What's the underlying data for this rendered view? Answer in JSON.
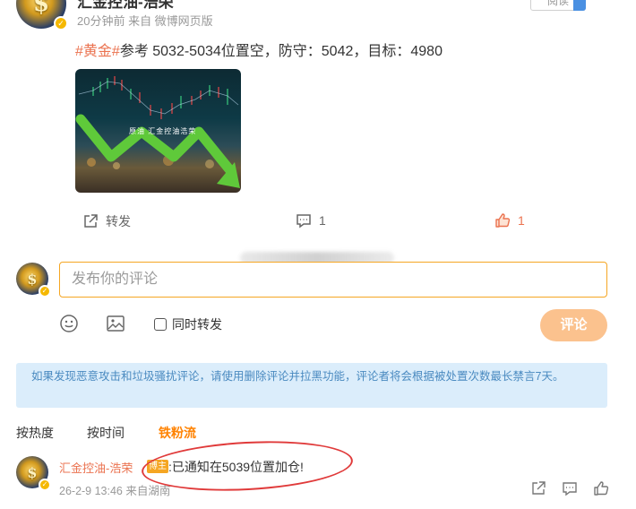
{
  "post": {
    "author": "汇金控油-浩荣",
    "meta": "20分钟前  来自 微博网页版",
    "follow_label": "阅读",
    "hashtag": "#黄金#",
    "text": "参考 5032-5034位置空，防守：5042，目标：4980",
    "image_caption": "原油 汇金控油浩荣"
  },
  "actions": {
    "repost_label": "转发",
    "comment_count": "1",
    "like_count": "1"
  },
  "composer": {
    "placeholder": "发布你的评论",
    "repost_option_label": "同时转发",
    "submit_label": "评论"
  },
  "notice": "如果发现恶意攻击和垃圾骚扰评论，请使用删除评论并拉黑功能，评论者将会根据被处置次数最长禁言7天。",
  "sort_tabs": [
    "按热度",
    "按时间",
    "铁粉流"
  ],
  "active_sort_tab": "铁粉流",
  "comment": {
    "author": "汇金控油-浩荣",
    "badge": "博主",
    "text": ":已通知在5039位置加仓!",
    "meta": "26-2-9 13:46  来自湖南"
  },
  "colors": {
    "accent_orange": "#ff8200",
    "link_orange": "#eb7350",
    "submit_disabled": "#fbc28e",
    "notice_bg": "#dbedfb",
    "annotation_red": "#e03a3a"
  },
  "icons": [
    "verified-badge-icon",
    "share-icon",
    "comment-icon",
    "like-icon",
    "emoji-icon",
    "image-icon",
    "checkbox-icon"
  ]
}
